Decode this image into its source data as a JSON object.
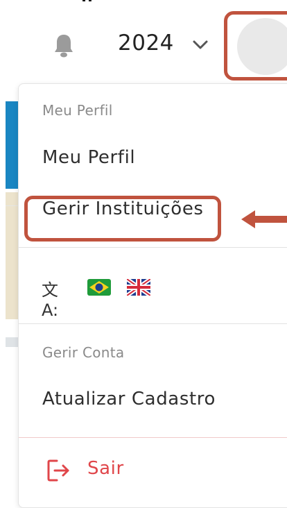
{
  "header": {
    "year": "2024",
    "icons": {
      "notifications": "bell-icon",
      "year_dropdown": "chevron-down-icon",
      "avatar": "avatar"
    }
  },
  "menu": {
    "profile_section_label": "Meu Perfil",
    "profile_item": "Meu Perfil",
    "institutions_item": "Gerir Instituições",
    "language_separator": ":",
    "account_section_label": "Gerir Conta",
    "update_registration_item": "Atualizar Cadastro",
    "logout_label": "Sair"
  },
  "colors": {
    "annotation": "#c0533e",
    "logout": "#e0464a",
    "section_label": "#8a8a8a"
  }
}
